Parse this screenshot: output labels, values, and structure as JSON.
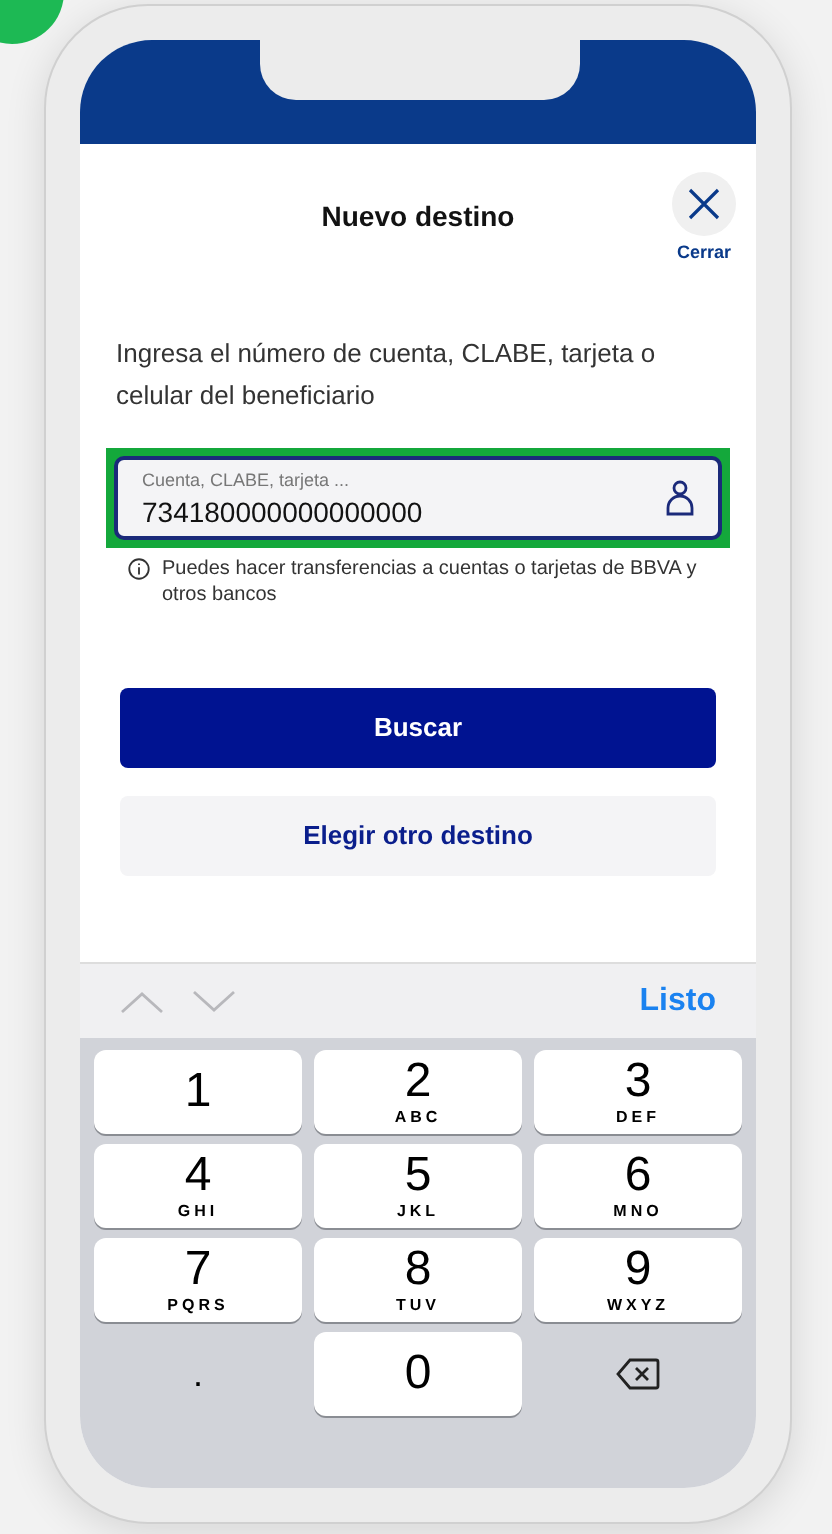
{
  "header": {
    "title": "Nuevo destino",
    "close_label": "Cerrar"
  },
  "instruction": "Ingresa el número de cuenta, CLABE, tarjeta o celular del beneficiario",
  "account_field": {
    "placeholder": "Cuenta, CLABE, tarjeta ...",
    "value": "734180000000000000",
    "highlighted": true
  },
  "info_note": "Puedes hacer transferencias a cuentas o tarjetas de BBVA y otros bancos",
  "buttons": [
    {
      "label": "Buscar",
      "kind": "primary"
    },
    {
      "label": "Elegir otro destino",
      "kind": "secondary"
    }
  ],
  "keyboard": {
    "done_label": "Listo",
    "keys": [
      {
        "kind": "digit",
        "digit": "1"
      },
      {
        "kind": "digit",
        "digit": "2",
        "letters": "ABC"
      },
      {
        "kind": "digit",
        "digit": "3",
        "letters": "DEF"
      },
      {
        "kind": "digit",
        "digit": "4",
        "letters": "GHI"
      },
      {
        "kind": "digit",
        "digit": "5",
        "letters": "JKL"
      },
      {
        "kind": "digit",
        "digit": "6",
        "letters": "MNO"
      },
      {
        "kind": "digit",
        "digit": "7",
        "letters": "PQRS"
      },
      {
        "kind": "digit",
        "digit": "8",
        "letters": "TUV"
      },
      {
        "kind": "digit",
        "digit": "9",
        "letters": "WXYZ"
      },
      {
        "kind": "dot",
        "digit": "."
      },
      {
        "kind": "digit",
        "digit": "0"
      },
      {
        "kind": "backspace"
      }
    ]
  }
}
